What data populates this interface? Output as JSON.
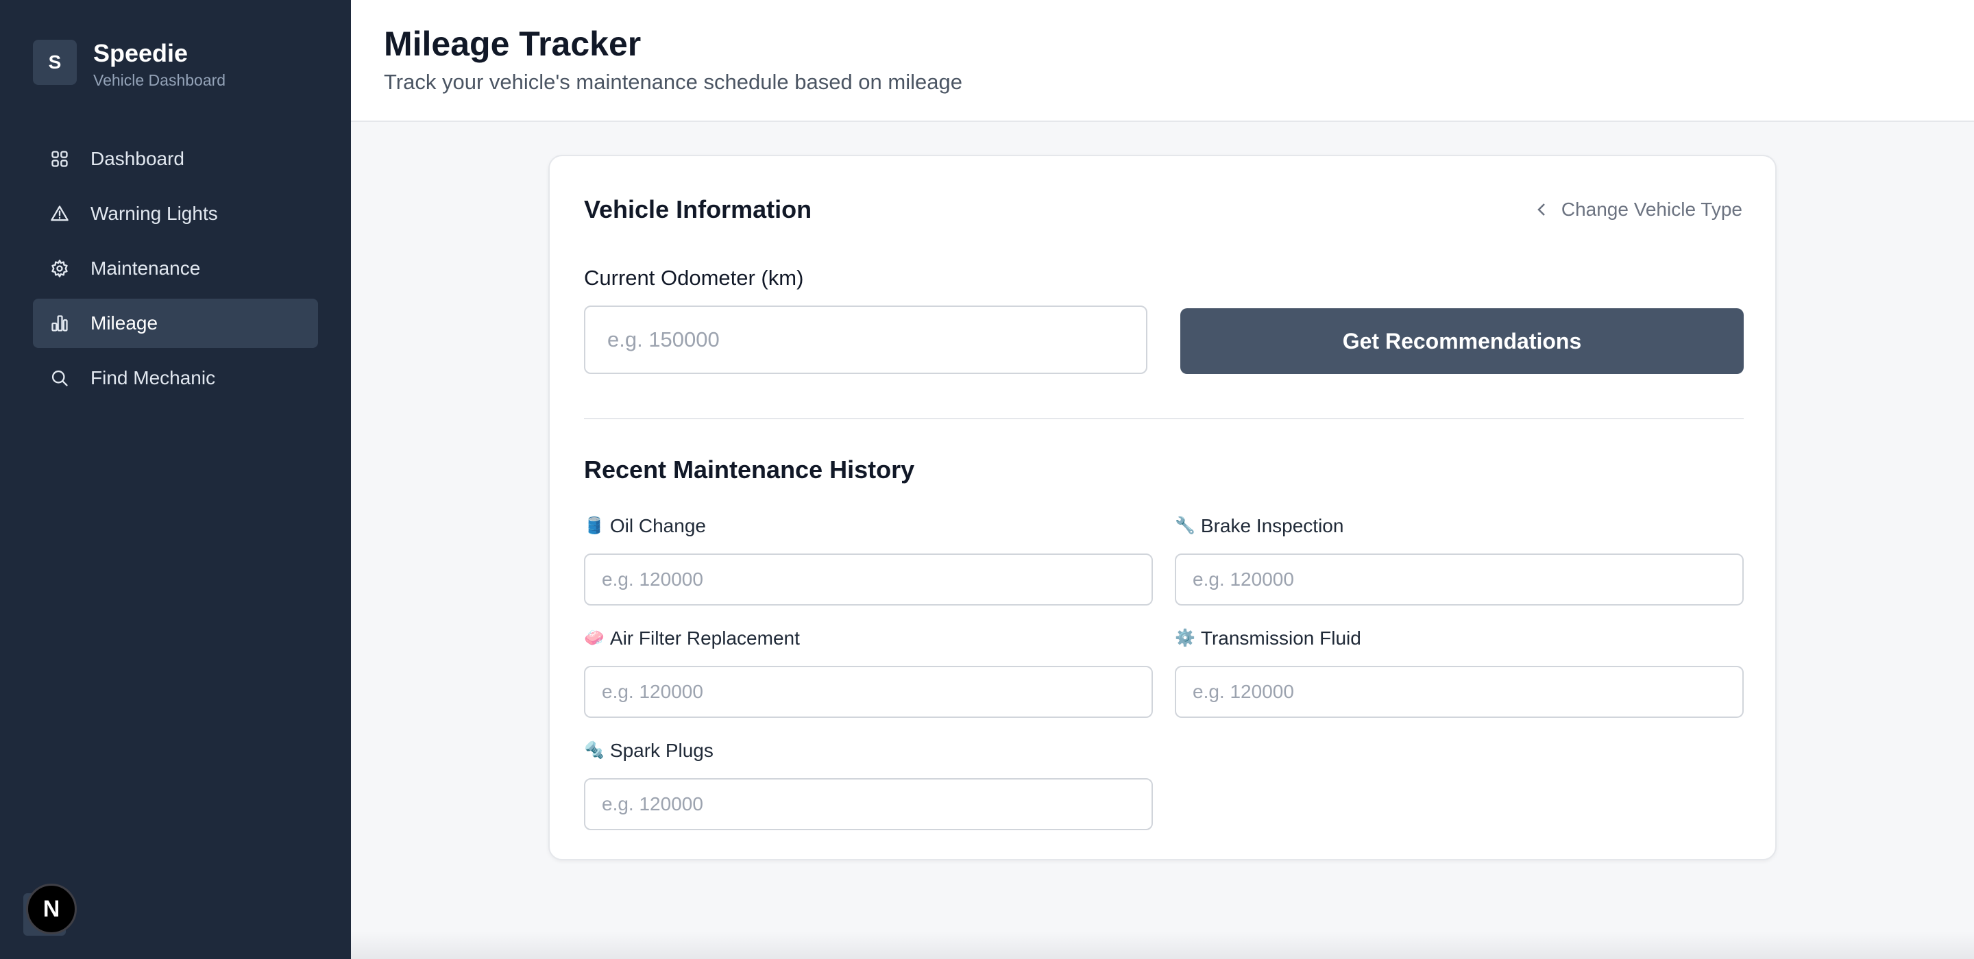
{
  "brand": {
    "logo_letter": "S",
    "name": "Speedie",
    "subtitle": "Vehicle Dashboard"
  },
  "nav": {
    "items": [
      {
        "label": "Dashboard",
        "icon": "grid-icon"
      },
      {
        "label": "Warning Lights",
        "icon": "warning-triangle-icon"
      },
      {
        "label": "Maintenance",
        "icon": "gear-icon"
      },
      {
        "label": "Mileage",
        "icon": "bar-chart-icon",
        "active": true
      },
      {
        "label": "Find Mechanic",
        "icon": "search-icon"
      }
    ]
  },
  "badge": {
    "letter": "N"
  },
  "header": {
    "title": "Mileage Tracker",
    "subtitle": "Track your vehicle's maintenance schedule based on mileage"
  },
  "vehicle_info": {
    "title": "Vehicle Information",
    "change_type_label": "Change Vehicle Type",
    "odometer_label": "Current Odometer (km)",
    "odometer_value": "",
    "odometer_placeholder": "e.g. 150000",
    "recommend_button": "Get Recommendations"
  },
  "history": {
    "title": "Recent Maintenance History",
    "fields": [
      {
        "emoji": "🛢️",
        "label": "Oil Change",
        "value": "",
        "placeholder": "e.g. 120000"
      },
      {
        "emoji": "🔧",
        "label": "Brake Inspection",
        "value": "",
        "placeholder": "e.g. 120000"
      },
      {
        "emoji": "🧼",
        "label": "Air Filter Replacement",
        "value": "",
        "placeholder": "e.g. 120000"
      },
      {
        "emoji": "⚙️",
        "label": "Transmission Fluid",
        "value": "",
        "placeholder": "e.g. 120000"
      },
      {
        "emoji": "🔩",
        "label": "Spark Plugs",
        "value": "",
        "placeholder": "e.g. 120000"
      }
    ]
  },
  "colors": {
    "sidebar_bg": "#1e293b",
    "sidebar_active": "#334155",
    "button_bg": "#475569",
    "page_bg": "#f6f7f9"
  }
}
